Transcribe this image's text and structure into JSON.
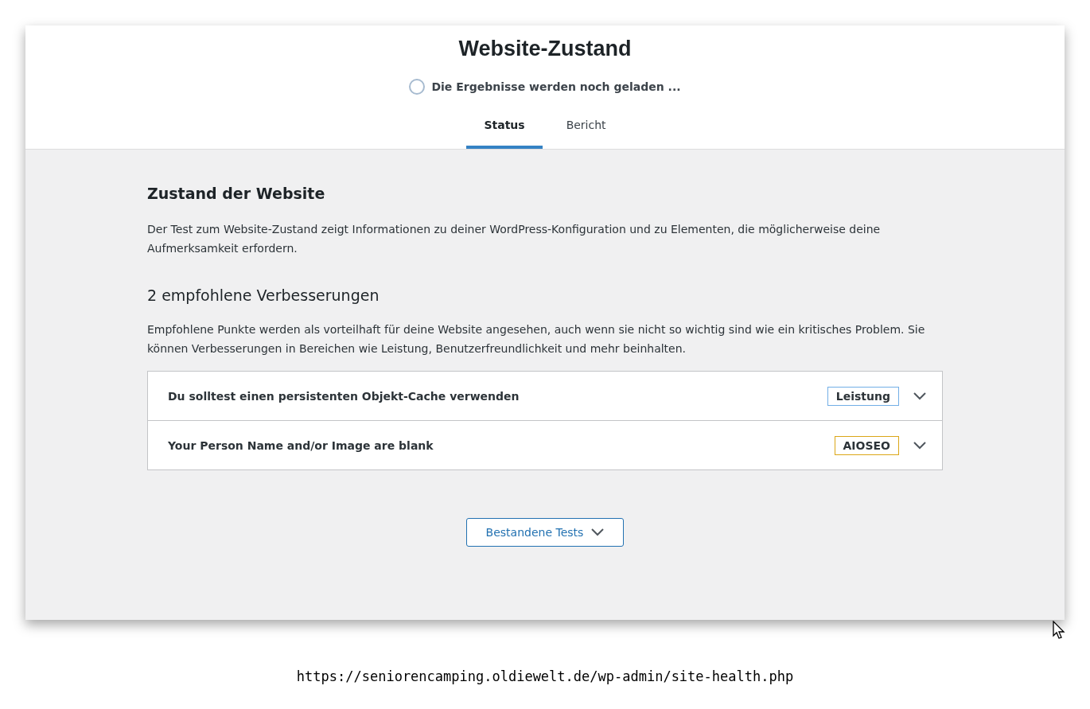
{
  "header": {
    "title": "Website-Zustand",
    "loading_text": "Die Ergebnisse werden noch geladen ..."
  },
  "tabs": [
    {
      "label": "Status",
      "selected": true
    },
    {
      "label": "Bericht",
      "selected": false
    }
  ],
  "intro": {
    "heading": "Zustand der Website",
    "text": "Der Test zum Website-Zustand zeigt Informationen zu deiner WordPress-Konfiguration und zu Elementen, die möglicherweise deine Aufmerksamkeit erfordern."
  },
  "recommended": {
    "heading": "2 empfohlene Verbesserungen",
    "text": "Empfohlene Punkte werden als vorteilhaft für deine Website angesehen, auch wenn sie nicht so wichtig sind wie ein kritisches Problem. Sie können Verbesserungen in Bereichen wie Leistung, Benutzerfreundlichkeit und mehr beinhalten.",
    "items": [
      {
        "title": "Du solltest einen persistenten Objekt-Cache verwenden",
        "badge": "Leistung",
        "color": "#72aee6",
        "expanded": false
      },
      {
        "title": "Your Person Name and/or Image are blank",
        "badge": "AIOSEO",
        "color": "#dba617",
        "expanded": false
      }
    ]
  },
  "passed_button": "Bestandene Tests",
  "url": "https://seniorencamping.oldiewelt.de/wp-admin/site-health.php"
}
